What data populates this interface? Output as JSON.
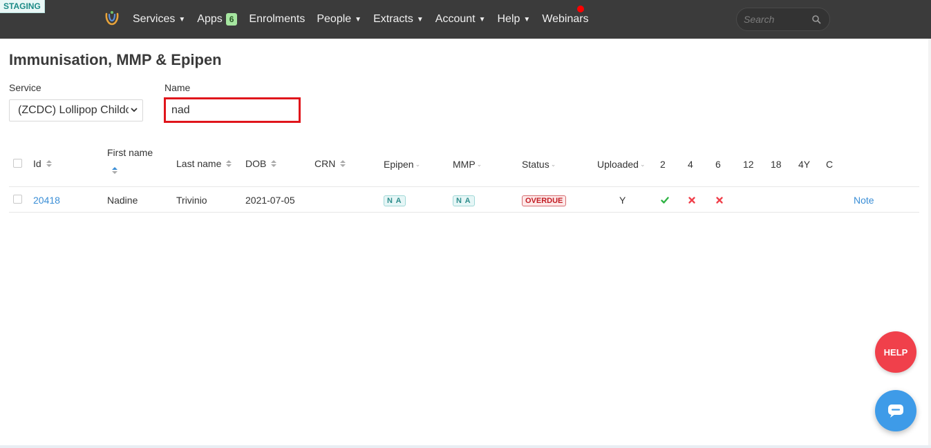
{
  "env_badge": "STAGING",
  "nav": {
    "items": [
      {
        "label": "Services",
        "caret": true
      },
      {
        "label": "Apps",
        "badge": "6"
      },
      {
        "label": "Enrolments"
      },
      {
        "label": "People",
        "caret": true
      },
      {
        "label": "Extracts",
        "caret": true
      },
      {
        "label": "Account",
        "caret": true
      },
      {
        "label": "Help",
        "caret": true
      },
      {
        "label": "Webinars"
      }
    ],
    "search_placeholder": "Search"
  },
  "page": {
    "title": "Immunisation, MMP & Epipen",
    "service_label": "Service",
    "service_value": "(ZCDC) Lollipop Childcare",
    "name_label": "Name",
    "name_value": "nad"
  },
  "table": {
    "headers": {
      "id": "Id",
      "first_name": "First name",
      "last_name": "Last name",
      "dob": "DOB",
      "crn": "CRN",
      "epipen": "Epipen",
      "mmp": "MMP",
      "status": "Status",
      "uploaded": "Uploaded",
      "c2": "2",
      "c4": "4",
      "c6": "6",
      "c12": "12",
      "c18": "18",
      "c4y": "4Y",
      "cc": "C"
    },
    "rows": [
      {
        "id": "20418",
        "first_name": "Nadine",
        "last_name": "Trivinio",
        "dob": "2021-07-05",
        "crn": "",
        "epipen": "N A",
        "mmp": "N A",
        "status": "OVERDUE",
        "uploaded": "Y",
        "c2": "check",
        "c4": "cross",
        "c6": "cross",
        "note": "Note"
      }
    ]
  },
  "floating": {
    "help_label": "HELP"
  },
  "colors": {
    "navbar": "#3b3b3b",
    "link": "#3a8ed6",
    "overdue": "#c21d24",
    "check": "#2fb344",
    "cross": "#f0404b",
    "help_button": "#f0404b",
    "chat_button": "#3e9be8"
  }
}
